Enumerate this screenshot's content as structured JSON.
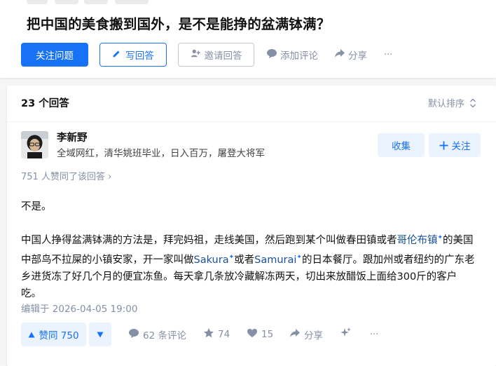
{
  "question": {
    "title": "把中国的美食搬到国外，是不是能挣的盆满钵满？",
    "follow_label": "关注问题",
    "write_label": "写回答",
    "invite_label": "邀请回答",
    "comment_label": "添加评论",
    "share_label": "分享",
    "more_label": "···"
  },
  "list": {
    "count_label": "23 个回答",
    "sort_label": "默认排序"
  },
  "answer": {
    "author_name": "李新野",
    "author_headline": "全域网红，清华姚班毕业，日入百万，屠登大将军",
    "collect_label": "收集",
    "follow_label": "关注",
    "upvoted_text": "751 人赞同了该回答 ›",
    "para1": "不是。",
    "para2_a": "中国人挣得盆满钵满的方法是，拜完妈祖，走线美国，然后跑到某个叫做春田镇或者",
    "link1": "哥伦布镇",
    "para2_b": "的美国中部鸟不拉屎的小镇安家，开一家叫做",
    "link2": "Sakura",
    "para2_c": "或者",
    "link3": "Samurai",
    "para2_d": "的日本餐厅。跟加州或者纽约的广东老乡进货冻了好几个月的便宜冻鱼。每天拿几条放冷藏解冻两天，切出来放醋饭上面给300斤的客户吃。",
    "link_mark": "✦",
    "edited": "编辑于 2026-04-05 19:00",
    "vote_label": "赞同 750",
    "comments_label": "62 条评论",
    "star_count": "74",
    "like_count": "15",
    "share_label": "分享",
    "more_label": "···"
  },
  "colors": {
    "brand": "#1772f6",
    "muted": "#8590a6",
    "light_blue": "#eaf3fe"
  }
}
